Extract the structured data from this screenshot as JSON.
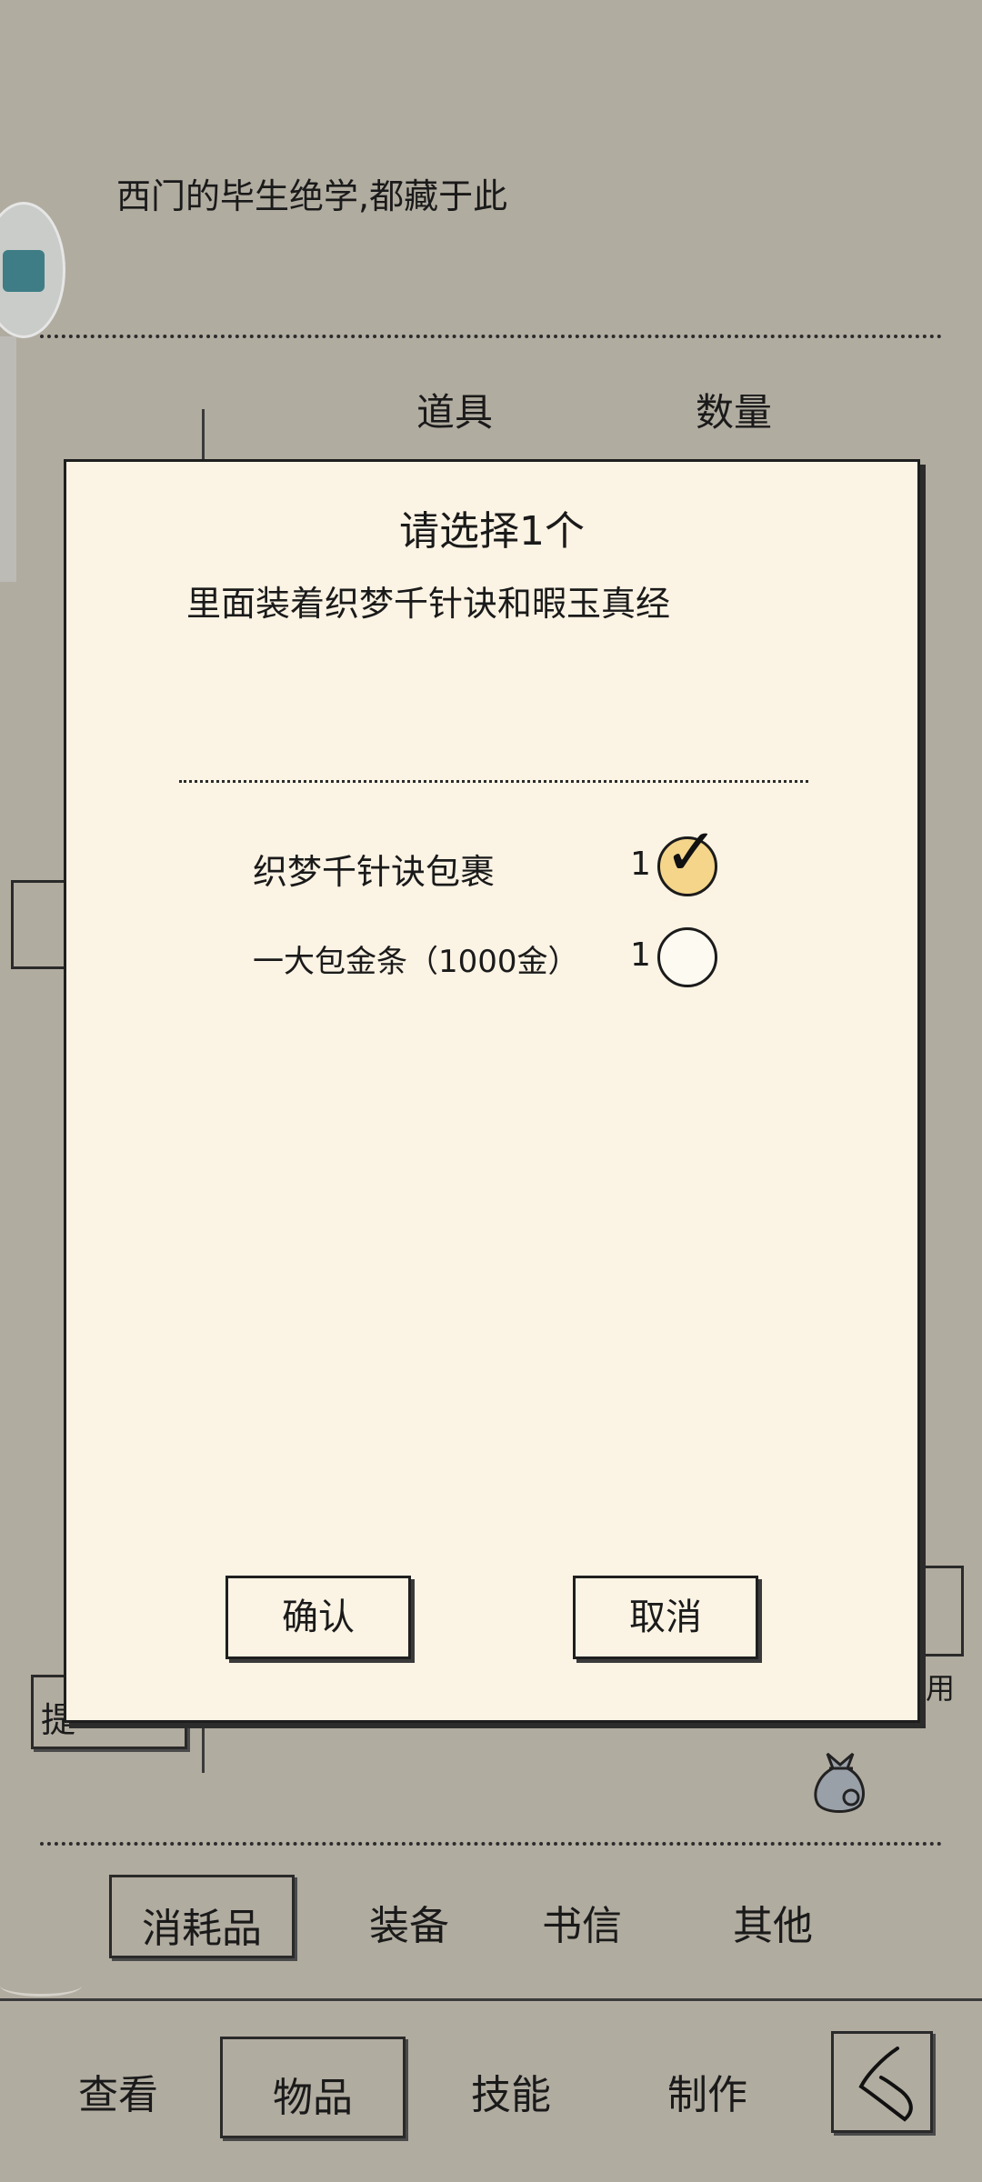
{
  "header": {
    "description": "西门的毕生绝学,都藏于此"
  },
  "table": {
    "columns": [
      "道具",
      "数量"
    ]
  },
  "background": {
    "left_button_partial": "提",
    "right_button_partial": "用"
  },
  "dialog": {
    "title": "请选择1个",
    "description": "里面装着织梦千针诀和暇玉真经",
    "options": [
      {
        "label": "织梦千针诀包裹",
        "count": "1",
        "selected": true
      },
      {
        "label": "一大包金条（1000金）",
        "count": "1",
        "selected": false
      }
    ],
    "confirm_label": "确认",
    "cancel_label": "取消"
  },
  "category_tabs": [
    {
      "label": "消耗品",
      "active": true
    },
    {
      "label": "装备",
      "active": false
    },
    {
      "label": "书信",
      "active": false
    },
    {
      "label": "其他",
      "active": false
    }
  ],
  "bottom_nav": [
    {
      "label": "查看",
      "active": false
    },
    {
      "label": "物品",
      "active": true
    },
    {
      "label": "技能",
      "active": false
    },
    {
      "label": "制作",
      "active": false
    }
  ],
  "icons": {
    "floating": "app-badge-icon",
    "money_bag": "money-bag-icon",
    "back": "back-arrow-icon",
    "check": "checkmark-icon"
  },
  "colors": {
    "background": "#b1aca0",
    "dialog_background": "#fbf3e4",
    "selected_radio": "#f4d58a"
  }
}
